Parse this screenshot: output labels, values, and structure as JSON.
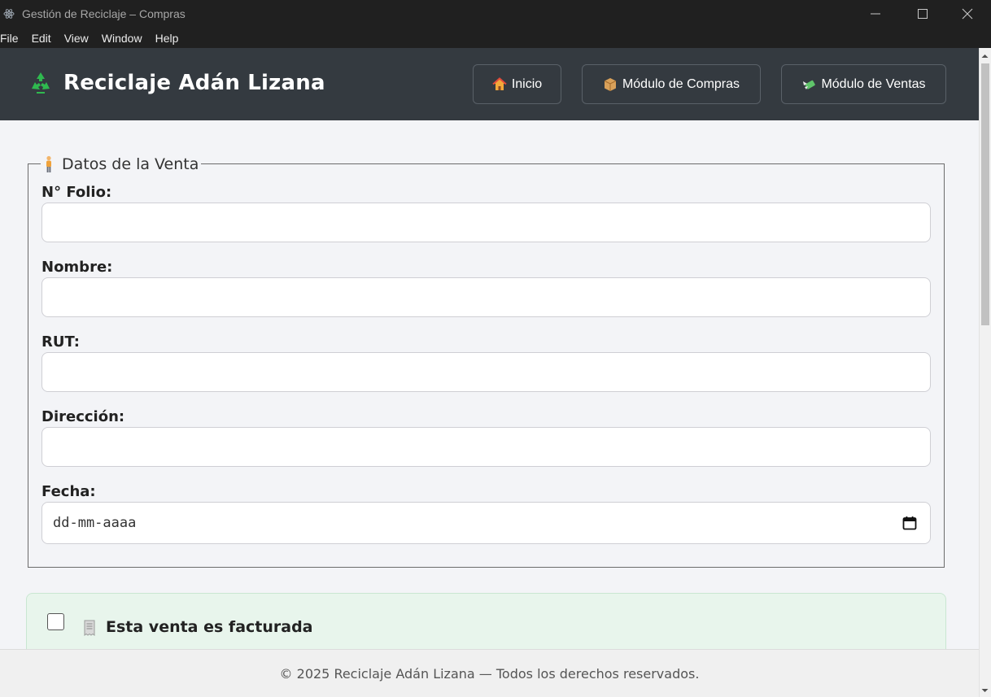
{
  "window": {
    "title": "Gestión de Reciclaje – Compras",
    "app_icon": "electron-icon",
    "controls": [
      "minimize-icon",
      "maximize-icon",
      "close-icon"
    ]
  },
  "menu": [
    "File",
    "Edit",
    "View",
    "Window",
    "Help"
  ],
  "header": {
    "brand_icon": "recycle-icon",
    "brand": "Reciclaje Adán Lizana",
    "nav": [
      {
        "label": "Inicio",
        "icon": "house-icon"
      },
      {
        "label": "Módulo de Compras",
        "icon": "package-icon"
      },
      {
        "label": "Módulo de Ventas",
        "icon": "money-wings-icon"
      }
    ]
  },
  "form": {
    "legend": "Datos de la Venta",
    "legend_icon": "person-icon",
    "fields": [
      {
        "label": "N° Folio:",
        "value": ""
      },
      {
        "label": "Nombre:",
        "value": ""
      },
      {
        "label": "RUT:",
        "value": ""
      },
      {
        "label": "Dirección:",
        "value": ""
      }
    ],
    "date": {
      "label": "Fecha:",
      "placeholder": "dd-mm-aaaa",
      "icon": "calendar-icon"
    }
  },
  "invoice": {
    "checked": false,
    "icon": "receipt-icon",
    "label": "Esta venta es facturada"
  },
  "footer": {
    "text": "© 2025 Reciclaje Adán Lizana — Todos los derechos reservados."
  },
  "colors": {
    "header_bg": "#343a40",
    "page_bg": "#f3f4f7",
    "invoice_bg": "#e8f5ec",
    "titlebar_bg": "#202020"
  }
}
